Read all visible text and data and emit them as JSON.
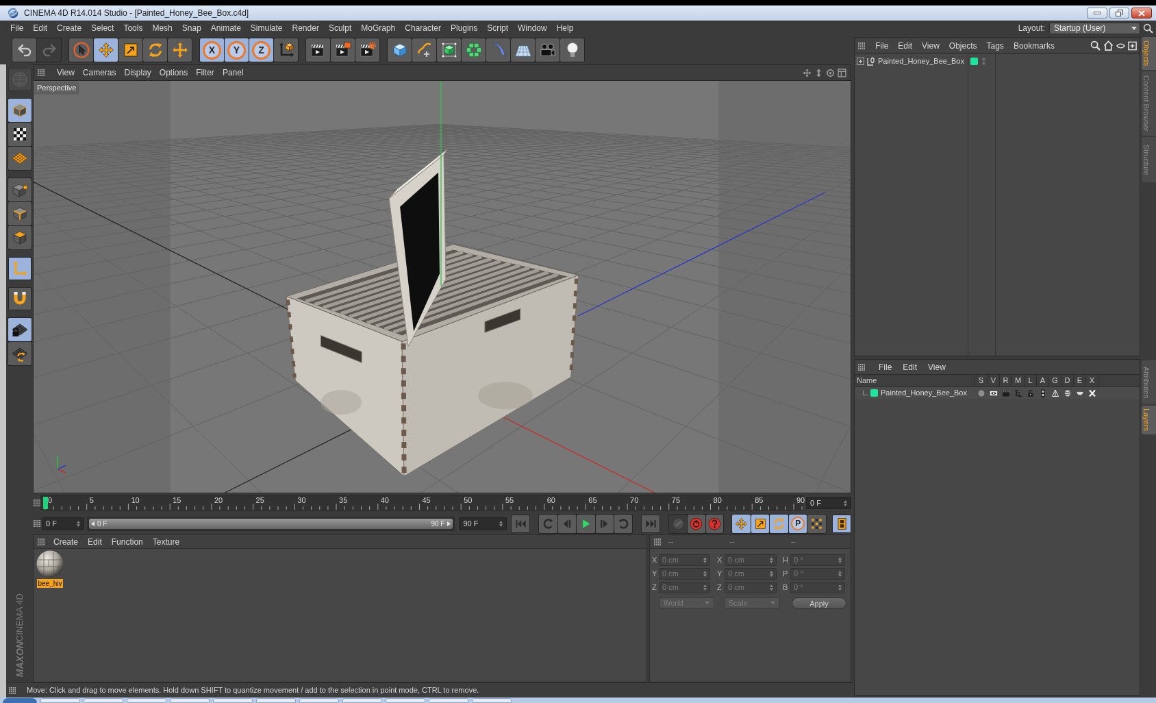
{
  "window": {
    "title": "CINEMA 4D R14.014 Studio - [Painted_Honey_Bee_Box.c4d]"
  },
  "menu_bar": {
    "items": [
      "File",
      "Edit",
      "Create",
      "Select",
      "Tools",
      "Mesh",
      "Snap",
      "Animate",
      "Simulate",
      "Render",
      "Sculpt",
      "MoGraph",
      "Character",
      "Plugins",
      "Script",
      "Window",
      "Help"
    ],
    "layout_label": "Layout:",
    "layout_value": "Startup (User)"
  },
  "toolbar": {
    "groups": [
      {
        "buttons": [
          {
            "active": false,
            "disabled": false
          },
          {
            "active": false,
            "disabled": true
          }
        ]
      },
      {
        "buttons": [
          {
            "active": false,
            "disabled": false
          },
          {
            "active": true,
            "disabled": false
          },
          {
            "active": false,
            "disabled": false
          },
          {
            "active": false,
            "disabled": false
          },
          {
            "active": false,
            "disabled": false
          }
        ]
      },
      {
        "buttons": [
          {
            "label": "X",
            "active": true,
            "disabled": false
          },
          {
            "label": "Y",
            "active": true,
            "disabled": false
          },
          {
            "label": "Z",
            "active": true,
            "disabled": false
          },
          {
            "active": false,
            "disabled": false
          }
        ]
      },
      {
        "buttons": [
          {
            "active": false,
            "disabled": false
          },
          {
            "active": false,
            "disabled": false
          },
          {
            "active": false,
            "disabled": false
          }
        ]
      },
      {
        "buttons": [
          {
            "active": false,
            "disabled": false
          },
          {
            "active": false,
            "disabled": false
          },
          {
            "active": false,
            "disabled": false
          },
          {
            "active": false,
            "disabled": false
          },
          {
            "active": false,
            "disabled": false
          },
          {
            "active": false,
            "disabled": false
          },
          {
            "active": false,
            "disabled": false
          },
          {
            "active": false,
            "disabled": false
          }
        ]
      }
    ]
  },
  "left_toolbar": {
    "groups": [
      {
        "buttons": [
          {
            "active": false,
            "disabled": true
          }
        ]
      },
      {
        "buttons": [
          {
            "active": true,
            "disabled": false
          },
          {
            "active": false,
            "disabled": false
          },
          {
            "active": false,
            "disabled": false
          }
        ]
      },
      {
        "buttons": [
          {
            "active": false,
            "disabled": false
          },
          {
            "active": false,
            "disabled": false
          },
          {
            "active": false,
            "disabled": false
          }
        ]
      },
      {
        "buttons": [
          {
            "active": true,
            "disabled": false
          }
        ]
      },
      {
        "buttons": [
          {
            "active": false,
            "disabled": false
          }
        ]
      },
      {
        "buttons": [
          {
            "active": true,
            "disabled": false
          },
          {
            "active": false,
            "disabled": false
          }
        ]
      }
    ]
  },
  "brand": {
    "lines": [
      "MAXON",
      "CINEMA 4D"
    ]
  },
  "viewport": {
    "menu": [
      "View",
      "Cameras",
      "Display",
      "Options",
      "Filter",
      "Panel"
    ],
    "camera_label": "Perspective"
  },
  "timeline": {
    "ticks": [
      "0",
      "5",
      "10",
      "15",
      "20",
      "25",
      "30",
      "35",
      "40",
      "45",
      "50",
      "55",
      "60",
      "65",
      "70",
      "75",
      "80",
      "85",
      "90"
    ],
    "playhead": {
      "level": 0
    },
    "current_frame": "0 F"
  },
  "playback": {
    "start_field": "0 F",
    "range_start": "0 F",
    "range_end": "90 F",
    "range": {
      "level": 1
    },
    "end_field": "90 F",
    "groups": [
      {
        "buttons": [
          {
            "active": false,
            "disabled": false
          }
        ]
      },
      {
        "buttons": [
          {
            "active": false,
            "disabled": false
          },
          {
            "active": false,
            "disabled": false
          },
          {
            "active": false,
            "disabled": false
          },
          {
            "active": false,
            "disabled": false
          },
          {
            "active": false,
            "disabled": false
          }
        ]
      },
      {
        "buttons": [
          {
            "active": false,
            "disabled": false
          }
        ]
      },
      {
        "buttons": [
          {
            "active": false,
            "disabled": true
          },
          {
            "active": false,
            "disabled": false
          },
          {
            "active": false,
            "disabled": false
          }
        ]
      },
      {
        "buttons": [
          {
            "active": true,
            "disabled": false
          },
          {
            "active": true,
            "disabled": false
          },
          {
            "active": true,
            "disabled": false
          },
          {
            "label": "P",
            "active": true,
            "disabled": false
          },
          {
            "active": false,
            "disabled": false
          }
        ]
      },
      {
        "buttons": [
          {
            "active": true,
            "disabled": false
          }
        ]
      }
    ]
  },
  "material_manager": {
    "menu": [
      "Create",
      "Edit",
      "Function",
      "Texture"
    ],
    "materials": [
      {
        "name": "bee_hiv",
        "selected": true
      }
    ]
  },
  "coordinates": {
    "headers": [
      "--",
      "--",
      "--"
    ],
    "rows": [
      {
        "position_axis": "X",
        "position": "0 cm",
        "size_axis": "X",
        "size": "0 cm",
        "rotation_axis": "H",
        "rotation": "0 °"
      },
      {
        "position_axis": "Y",
        "position": "0 cm",
        "size_axis": "Y",
        "size": "0 cm",
        "rotation_axis": "P",
        "rotation": "0 °"
      },
      {
        "position_axis": "Z",
        "position": "0 cm",
        "size_axis": "Z",
        "size": "0 cm",
        "rotation_axis": "B",
        "rotation": "0 °"
      }
    ],
    "mode": "World",
    "size_mode": "Scale",
    "apply": "Apply"
  },
  "status_bar": {
    "text": "Move: Click and drag to move elements. Hold down SHIFT to quantize movement / add to the selection in point mode, CTRL to remove."
  },
  "object_manager": {
    "menu": [
      "File",
      "Edit",
      "View",
      "Objects",
      "Tags",
      "Bookmarks"
    ],
    "objects": [
      {
        "name": "Painted_Honey_Bee_Box",
        "color": "#1fe39a",
        "expanded": false
      }
    ]
  },
  "layer_manager": {
    "menu": [
      "File",
      "Edit",
      "View"
    ],
    "columns": [
      "Name",
      "S",
      "V",
      "R",
      "M",
      "L",
      "A",
      "G",
      "D",
      "E",
      "X"
    ],
    "layers": [
      {
        "name": "Painted_Honey_Bee_Box",
        "color": "#1fe39a"
      }
    ]
  },
  "side_tabs": {
    "top": [
      {
        "label": "Objects",
        "selected": true
      },
      {
        "label": "Content Browser",
        "selected": false
      },
      {
        "label": "Structure",
        "selected": false
      }
    ],
    "bottom": [
      {
        "label": "Attributes",
        "selected": false
      },
      {
        "label": "Layers",
        "selected": true
      }
    ]
  }
}
